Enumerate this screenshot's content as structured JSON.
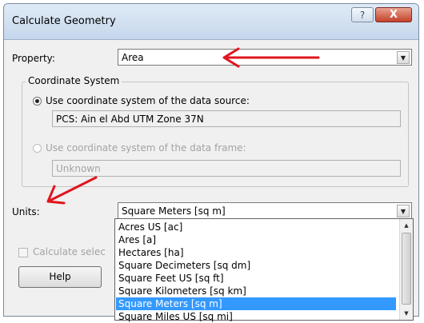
{
  "window": {
    "title": "Calculate Geometry",
    "help_glyph": "?",
    "close_glyph": "X"
  },
  "property": {
    "label": "Property:",
    "value": "Area"
  },
  "coordinate_system": {
    "title": "Coordinate System",
    "source_option_label": "Use coordinate system of the data source:",
    "source_value": "PCS: Ain el Abd UTM Zone 37N",
    "frame_option_label": "Use coordinate system of the data frame:",
    "frame_value": "Unknown"
  },
  "units": {
    "label": "Units:",
    "selected": "Square Meters [sq m]",
    "options": [
      "Acres US [ac]",
      "Ares [a]",
      "Hectares [ha]",
      "Square Decimeters [sq dm]",
      "Square Feet US [sq ft]",
      "Square Kilometers [sq km]",
      "Square Meters [sq m]",
      "Square Miles US [sq mi]"
    ]
  },
  "calc_selected": {
    "label": "Calculate selec"
  },
  "buttons": {
    "help_label": "Help"
  },
  "colors": {
    "selection": "#3399ff",
    "annotation_arrow": "#e0161e"
  }
}
